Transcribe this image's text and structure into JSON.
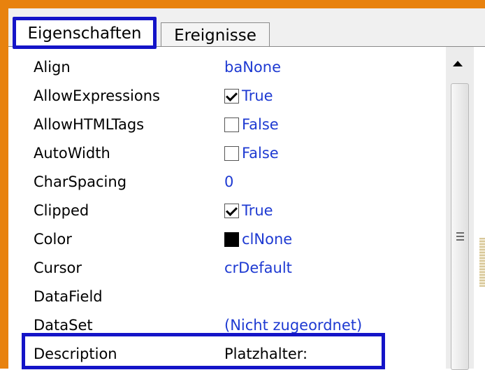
{
  "tabs": [
    {
      "label": "Eigenschaften",
      "active": true
    },
    {
      "label": "Ereignisse",
      "active": false
    }
  ],
  "properties": [
    {
      "name": "Align",
      "value": "baNone",
      "kind": "text"
    },
    {
      "name": "AllowExpressions",
      "value": "True",
      "kind": "checkbox",
      "checked": true
    },
    {
      "name": "AllowHTMLTags",
      "value": "False",
      "kind": "checkbox",
      "checked": false
    },
    {
      "name": "AutoWidth",
      "value": "False",
      "kind": "checkbox",
      "checked": false
    },
    {
      "name": "CharSpacing",
      "value": "0",
      "kind": "text"
    },
    {
      "name": "Clipped",
      "value": "True",
      "kind": "checkbox",
      "checked": true
    },
    {
      "name": "Color",
      "value": "clNone",
      "kind": "color",
      "swatch": "#000000"
    },
    {
      "name": "Cursor",
      "value": "crDefault",
      "kind": "text"
    },
    {
      "name": "DataField",
      "value": "",
      "kind": "text"
    },
    {
      "name": "DataSet",
      "value": "(Nicht zugeordnet)",
      "kind": "text"
    },
    {
      "name": "Description",
      "value": "Platzhalter:",
      "kind": "text",
      "highlighted": true
    }
  ],
  "colors": {
    "frame": "#e8820e",
    "highlight": "#1414c8",
    "value_text": "#1e3ad2"
  }
}
